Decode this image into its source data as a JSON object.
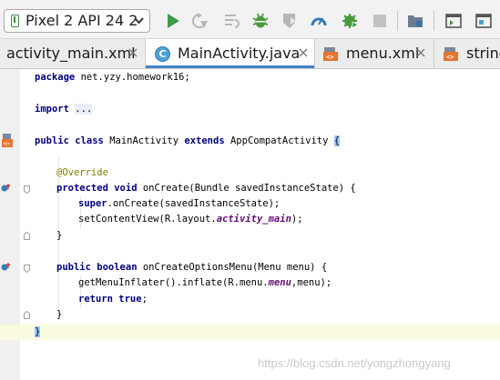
{
  "toolbar": {
    "device": "Pixel 2 API 24 2",
    "icons": [
      "run-icon",
      "apply-changes-icon",
      "apply-code-changes-icon",
      "debug-icon",
      "attach-debugger-icon",
      "profile-icon",
      "run-coverage-icon",
      "stop-icon",
      "project-structure-icon",
      "terminal-icon",
      "layout-icon"
    ]
  },
  "tabs": [
    {
      "label": "activity_main.xml",
      "type": "xml",
      "active": false
    },
    {
      "label": "MainActivity.java",
      "type": "class",
      "active": true
    },
    {
      "label": "menu.xml",
      "type": "xml",
      "active": false
    },
    {
      "label": "string",
      "type": "xml",
      "active": false
    }
  ],
  "code": {
    "package_kw": "package",
    "package_name": " net.yzy.homework16;",
    "import_kw": "import",
    "import_fold": "...",
    "class_public": "public",
    "class_kw": "class",
    "class_name": " MainActivity ",
    "extends_kw": "extends",
    "super_class": " AppCompatActivity ",
    "open_brace": "{",
    "override_ann": "@Override",
    "m1_protected": "protected",
    "m1_void": "void",
    "m1_sig": " onCreate(Bundle savedInstanceState) {",
    "m1_super": "super",
    "m1_super_call": ".onCreate(savedInstanceState);",
    "m1_setcontent": "setContentView(R.layout.",
    "m1_field": "activity_main",
    "m1_setcontent_end": ");",
    "m1_close": "}",
    "m2_public": "public",
    "m2_boolean": "boolean",
    "m2_sig": " onCreateOptionsMenu(Menu menu) {",
    "m2_inflate": "getMenuInflater().inflate(R.menu.",
    "m2_field": "menu",
    "m2_inflate_end": ",menu);",
    "m2_return": "return",
    "m2_true": "true",
    "m2_semicolon": ";",
    "m2_close": "}",
    "class_close": "}"
  },
  "watermark": "https://blog.csdn.net/yongzhongyang"
}
